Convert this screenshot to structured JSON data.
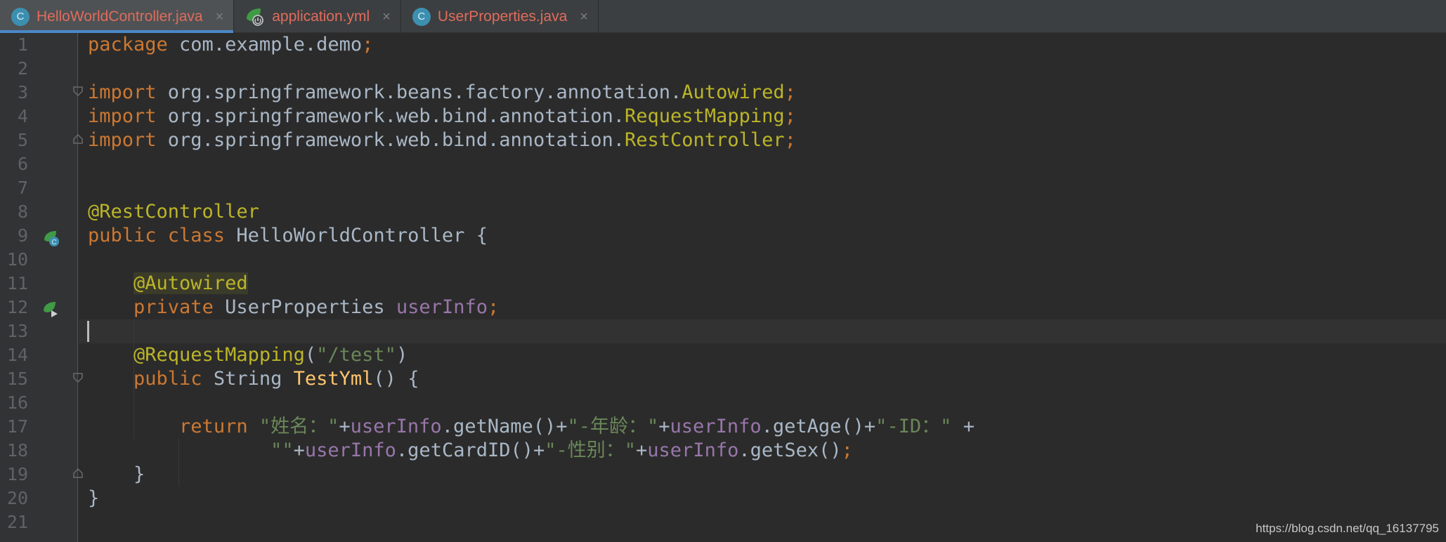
{
  "tabs": [
    {
      "label": "HelloWorldController.java",
      "icon": "class-icon",
      "active": true
    },
    {
      "label": "application.yml",
      "icon": "spring-config-icon",
      "active": false
    },
    {
      "label": "UserProperties.java",
      "icon": "class-icon",
      "active": false
    }
  ],
  "tab_close_glyph": "×",
  "class_icon_letter": "C",
  "watermark": "https://blog.csdn.net/qq_16137795",
  "colors": {
    "keyword": "#cc7832",
    "annotation": "#bbb529",
    "string": "#6a8759",
    "field": "#9876aa",
    "method": "#ffc66d",
    "plain": "#a9b7c6",
    "active_tab_text": "#e06c5c",
    "inactive_tab_text": "#e06c5c"
  },
  "lines": [
    {
      "n": "1",
      "tokens": [
        [
          "kw",
          "package "
        ],
        [
          "pl",
          "com.example.demo"
        ],
        [
          "kw",
          ";"
        ]
      ]
    },
    {
      "n": "2",
      "tokens": []
    },
    {
      "n": "3",
      "tokens": [
        [
          "kw",
          "import "
        ],
        [
          "pl",
          "org.springframework.beans.factory.annotation."
        ],
        [
          "ann",
          "Autowired"
        ],
        [
          "kw",
          ";"
        ]
      ]
    },
    {
      "n": "4",
      "tokens": [
        [
          "kw",
          "import "
        ],
        [
          "pl",
          "org.springframework.web.bind.annotation."
        ],
        [
          "ann",
          "RequestMapping"
        ],
        [
          "kw",
          ";"
        ]
      ]
    },
    {
      "n": "5",
      "tokens": [
        [
          "kw",
          "import "
        ],
        [
          "pl",
          "org.springframework.web.bind.annotation."
        ],
        [
          "ann",
          "RestController"
        ],
        [
          "kw",
          ";"
        ]
      ]
    },
    {
      "n": "6",
      "tokens": []
    },
    {
      "n": "7",
      "tokens": []
    },
    {
      "n": "8",
      "tokens": [
        [
          "ann",
          "@RestController"
        ]
      ]
    },
    {
      "n": "9",
      "tokens": [
        [
          "kw",
          "public class "
        ],
        [
          "pl",
          "HelloWorldController {"
        ]
      ]
    },
    {
      "n": "10",
      "tokens": []
    },
    {
      "n": "11",
      "tokens": [
        [
          "pl",
          "    "
        ],
        [
          "ann-hl",
          "@Autowired"
        ]
      ]
    },
    {
      "n": "12",
      "tokens": [
        [
          "pl",
          "    "
        ],
        [
          "kw",
          "private "
        ],
        [
          "pl",
          "UserProperties "
        ],
        [
          "fld",
          "userInfo"
        ],
        [
          "kw",
          ";"
        ]
      ]
    },
    {
      "n": "13",
      "tokens": []
    },
    {
      "n": "14",
      "tokens": [
        [
          "pl",
          "    "
        ],
        [
          "ann",
          "@RequestMapping"
        ],
        [
          "pl",
          "("
        ],
        [
          "str",
          "\"/test\""
        ],
        [
          "pl",
          ")"
        ]
      ]
    },
    {
      "n": "15",
      "tokens": [
        [
          "pl",
          "    "
        ],
        [
          "kw",
          "public "
        ],
        [
          "pl",
          "String "
        ],
        [
          "fn",
          "TestYml"
        ],
        [
          "pl",
          "() {"
        ]
      ]
    },
    {
      "n": "16",
      "tokens": []
    },
    {
      "n": "17",
      "tokens": [
        [
          "pl",
          "        "
        ],
        [
          "kw",
          "return "
        ],
        [
          "str",
          "\"姓名："
        ],
        [
          "str",
          "\""
        ],
        [
          "pl",
          "+"
        ],
        [
          "fld",
          "userInfo"
        ],
        [
          "pl",
          ".getName()+"
        ],
        [
          "str",
          "\"-年龄：\""
        ],
        [
          "pl",
          "+"
        ],
        [
          "fld",
          "userInfo"
        ],
        [
          "pl",
          ".getAge()+"
        ],
        [
          "str",
          "\"-ID：\""
        ],
        [
          "pl",
          " +"
        ]
      ]
    },
    {
      "n": "18",
      "tokens": [
        [
          "pl",
          "                "
        ],
        [
          "str",
          "\"\""
        ],
        [
          "pl",
          "+"
        ],
        [
          "fld",
          "userInfo"
        ],
        [
          "pl",
          ".getCardID()+"
        ],
        [
          "str",
          "\"-性别：\""
        ],
        [
          "pl",
          "+"
        ],
        [
          "fld",
          "userInfo"
        ],
        [
          "pl",
          ".getSex()"
        ],
        [
          "kw",
          ";"
        ]
      ]
    },
    {
      "n": "19",
      "tokens": [
        [
          "pl",
          "    }"
        ]
      ]
    },
    {
      "n": "20",
      "tokens": [
        [
          "pl",
          "}"
        ]
      ]
    },
    {
      "n": "21",
      "tokens": []
    }
  ]
}
